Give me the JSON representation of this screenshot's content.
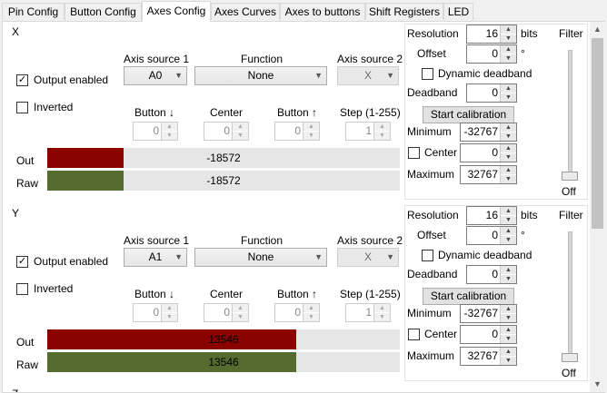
{
  "tabs": [
    "Pin Config",
    "Button Config",
    "Axes Config",
    "Axes Curves",
    "Axes to buttons",
    "Shift Registers",
    "LED"
  ],
  "active_tab": "Axes Config",
  "labels": {
    "output_enabled": "Output enabled",
    "inverted": "Inverted",
    "axis_source_1": "Axis source 1",
    "function": "Function",
    "axis_source_2": "Axis source 2",
    "button_down": "Button ↓",
    "center": "Center",
    "button_up": "Button ↑",
    "step": "Step (1-255)",
    "out": "Out",
    "raw": "Raw",
    "resolution": "Resolution",
    "bits": "bits",
    "filter": "Filter",
    "offset": "Offset",
    "degree": "°",
    "dynamic_deadband": "Dynamic deadband",
    "deadband": "Deadband",
    "start_calibration": "Start calibration",
    "minimum": "Minimum",
    "center_check": "Center",
    "maximum": "Maximum",
    "filter_value": "Off"
  },
  "colors": {
    "out_bar": "#8b0000",
    "raw_bar": "#556b2f",
    "track": "#e6e6e6"
  },
  "axes": [
    {
      "name": "X",
      "output_enabled": true,
      "inverted": false,
      "axis_source_1": "A0",
      "function": "None",
      "axis_source_2": "X",
      "button_down": "0",
      "center": "0",
      "button_up": "0",
      "step": "1",
      "out_value": "-18572",
      "raw_value": "-18572",
      "out_fraction": 0.217,
      "raw_fraction": 0.217,
      "resolution": "16",
      "offset": "0",
      "dynamic_deadband": false,
      "deadband": "0",
      "minimum": "-32767",
      "center_checked": false,
      "center_value": "0",
      "maximum": "32767"
    },
    {
      "name": "Y",
      "output_enabled": true,
      "inverted": false,
      "axis_source_1": "A1",
      "function": "None",
      "axis_source_2": "X",
      "button_down": "0",
      "center": "0",
      "button_up": "0",
      "step": "1",
      "out_value": "13546",
      "raw_value": "13546",
      "out_fraction": 0.707,
      "raw_fraction": 0.707,
      "resolution": "16",
      "offset": "0",
      "dynamic_deadband": false,
      "deadband": "0",
      "minimum": "-32767",
      "center_checked": false,
      "center_value": "0",
      "maximum": "32767"
    }
  ],
  "next_axis_name": "Z"
}
